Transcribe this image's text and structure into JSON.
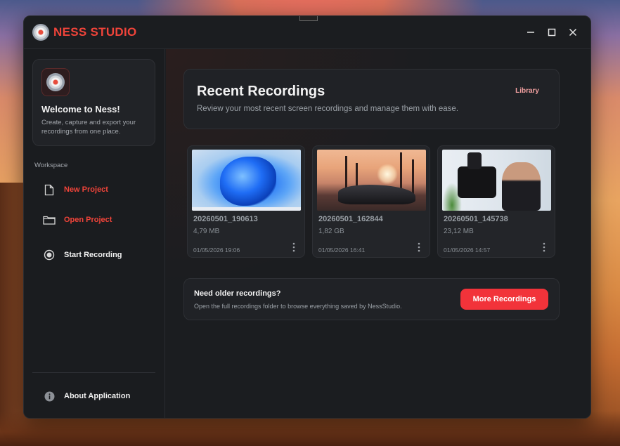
{
  "app": {
    "title": "NESS STUDIO"
  },
  "window_controls": {
    "minimize": "minimize-icon",
    "maximize": "maximize-icon",
    "close": "close-icon"
  },
  "sidebar": {
    "welcome": {
      "title": "Welcome to Ness!",
      "description": "Create, capture and export your recordings from one place."
    },
    "section_label": "Workspace",
    "items": [
      {
        "label": "New Project",
        "icon": "file-icon",
        "color": "#f0443a"
      },
      {
        "label": "Open Project",
        "icon": "folder-icon",
        "color": "#f0443a"
      },
      {
        "label": "Start Recording",
        "icon": "record-icon",
        "color": "#f0f0f0"
      }
    ],
    "footer_item": {
      "label": "About Application",
      "icon": "info-icon"
    }
  },
  "main": {
    "header": {
      "title": "Recent Recordings",
      "subtitle": "Review your most recent screen recordings and manage them with ease.",
      "library_link": "Library"
    },
    "recordings": [
      {
        "name": "20260501_190613",
        "size": "4,79 MB",
        "date": "01/05/2026 19:06",
        "thumbnail": "windows-bloom-wallpaper"
      },
      {
        "name": "20260501_162844",
        "size": "1,82 GB",
        "date": "01/05/2026 16:41",
        "thumbnail": "sports-car-sunset"
      },
      {
        "name": "20260501_145738",
        "size": "23,12 MB",
        "date": "01/05/2026 14:57",
        "thumbnail": "camera-and-presenter"
      }
    ],
    "older": {
      "title": "Need older recordings?",
      "description": "Open the full recordings folder to browse everything saved by NessStudio.",
      "button_label": "More Recordings"
    }
  },
  "colors": {
    "accent": "#f0443a",
    "button": "#f2333a",
    "background": "#1b1d20"
  }
}
